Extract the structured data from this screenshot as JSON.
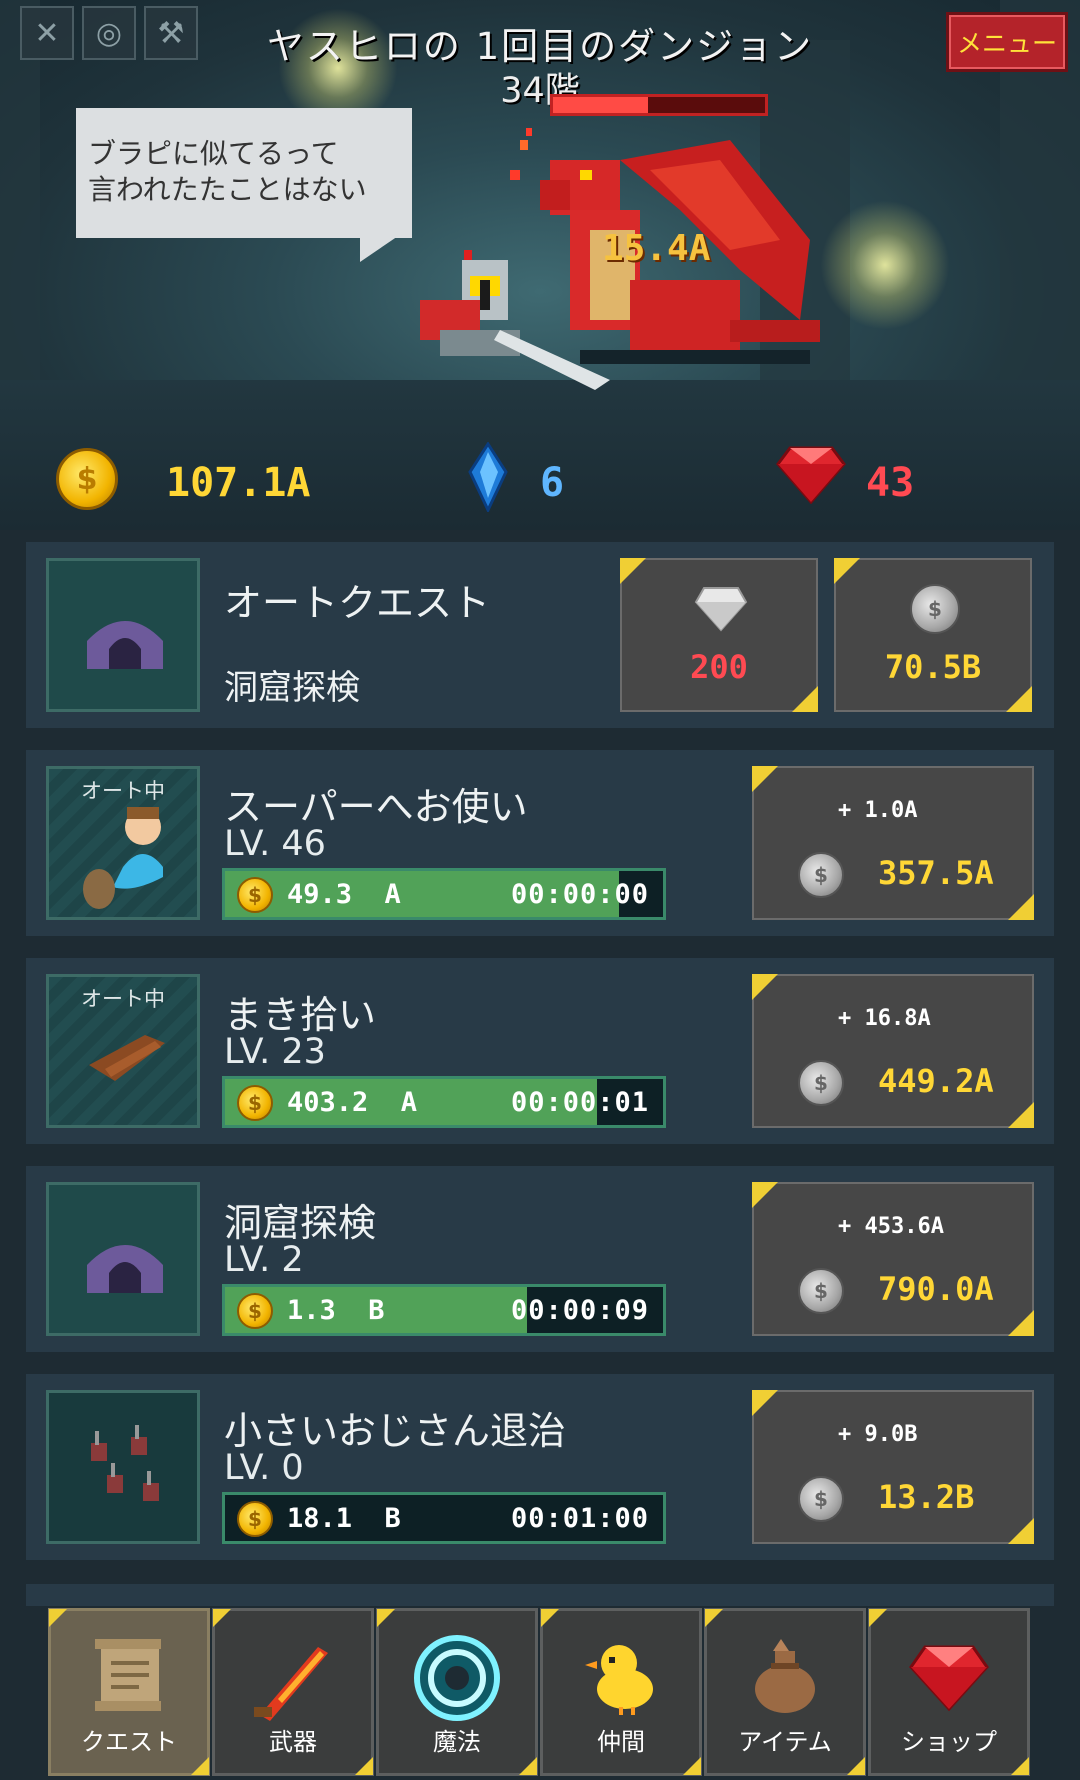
{
  "header": {
    "title": "ヤスヒロの 1回目のダンジョン",
    "floor": "34階",
    "menu_label": "メニュー",
    "boss_hp_fraction": 0.45,
    "top_icons": [
      "swords-icon",
      "rope-icon",
      "winged-boot-icon"
    ]
  },
  "scene": {
    "speech": [
      "ブラピに似てるって",
      "言われたたことはない"
    ],
    "damage_text": "15.4A"
  },
  "currency": {
    "gold": "107.1A",
    "crystal": "6",
    "gems": "43"
  },
  "auto_quest": {
    "title": "オートクエスト",
    "subtitle": "洞窟探検",
    "diamond_cost": "200",
    "coin_cost": "70.5B"
  },
  "quests": [
    {
      "name": "スーパーへお使い",
      "level": "LV. 46",
      "auto_label": "オート中",
      "amount": "49.3",
      "unit": "A",
      "time": "00:00:00",
      "progress": 0.9,
      "inc": "+ 1.0A",
      "cost": "357.5A"
    },
    {
      "name": "まき拾い",
      "level": "LV. 23",
      "auto_label": "オート中",
      "amount": "403.2",
      "unit": "A",
      "time": "00:00:01",
      "progress": 0.85,
      "inc": "+ 16.8A",
      "cost": "449.2A"
    },
    {
      "name": "洞窟探検",
      "level": "LV. 2",
      "auto_label": "",
      "amount": "1.3",
      "unit": "B",
      "time": "00:00:09",
      "progress": 0.69,
      "inc": "+ 453.6A",
      "cost": "790.0A"
    },
    {
      "name": "小さいおじさん退治",
      "level": "LV. 0",
      "auto_label": "",
      "amount": "18.1",
      "unit": "B",
      "time": "00:01:00",
      "progress": 0,
      "inc": "+ 9.0B",
      "cost": "13.2B"
    }
  ],
  "nav": [
    {
      "label": "クエスト",
      "icon": "scroll-icon"
    },
    {
      "label": "武器",
      "icon": "flame-sword-icon"
    },
    {
      "label": "魔法",
      "icon": "magic-circle-icon"
    },
    {
      "label": "仲間",
      "icon": "chick-icon"
    },
    {
      "label": "アイテム",
      "icon": "bag-icon"
    },
    {
      "label": "ショップ",
      "icon": "gem-icon"
    }
  ],
  "colors": {
    "gold": "#ffd736",
    "crystal": "#5fb6ff",
    "gem": "#ff4a52",
    "progress": "#51a258",
    "menu": "#b4232a"
  }
}
